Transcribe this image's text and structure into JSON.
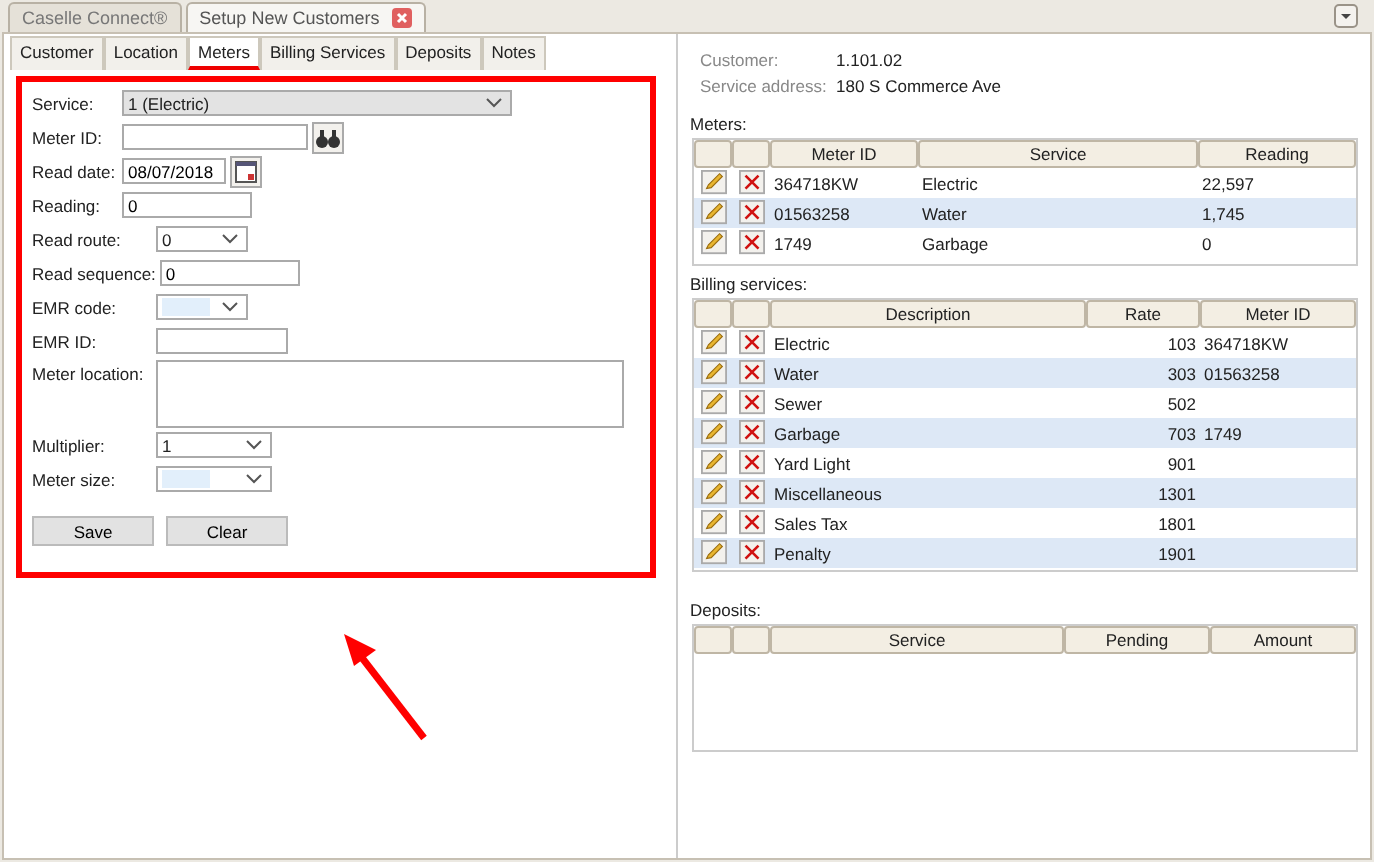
{
  "window_tabs": [
    {
      "label": "Caselle Connect®",
      "selected": false,
      "closable": false
    },
    {
      "label": "Setup New Customers",
      "selected": true,
      "closable": true
    }
  ],
  "tabs": [
    {
      "label": "Customer",
      "selected": false
    },
    {
      "label": "Location",
      "selected": false
    },
    {
      "label": "Meters",
      "selected": true
    },
    {
      "label": "Billing Services",
      "selected": false
    },
    {
      "label": "Deposits",
      "selected": false
    },
    {
      "label": "Notes",
      "selected": false
    }
  ],
  "form": {
    "fields": [
      {
        "kind": "select",
        "label": "Service:",
        "value": "1 (Electric)"
      },
      {
        "kind": "lookup",
        "label": "Meter ID:"
      },
      {
        "kind": "date",
        "label": "Read date:",
        "value": "08/07/2018"
      },
      {
        "kind": "text",
        "label": "Reading:",
        "value": "0"
      },
      {
        "kind": "select",
        "label": "Read route:",
        "value": "0"
      },
      {
        "kind": "text",
        "label": "Read sequence:",
        "value": "0"
      },
      {
        "kind": "select",
        "label": "EMR code:"
      },
      {
        "kind": "text",
        "label": "EMR ID:"
      },
      {
        "kind": "textarea",
        "label": "Meter location:"
      },
      {
        "kind": "select",
        "label": "Multiplier:",
        "value": "1"
      },
      {
        "kind": "select",
        "label": "Meter size:"
      }
    ],
    "buttons": [
      "Save",
      "Clear"
    ]
  },
  "customer": {
    "label": "Customer:",
    "value": "1.101.02"
  },
  "service_address": {
    "label": "Service address:",
    "value": "180 S Commerce Ave"
  },
  "meters": {
    "label": "Meters:",
    "columns": [
      "Meter ID",
      "Service",
      "Reading"
    ],
    "rows": [
      [
        "364718KW",
        "Electric",
        "22,597"
      ],
      [
        "01563258",
        "Water",
        "1,745"
      ],
      [
        "1749",
        "Garbage",
        "0"
      ]
    ]
  },
  "billing_services": {
    "label": "Billing services:",
    "columns": [
      "Description",
      "Rate",
      "Meter ID"
    ],
    "rows": [
      [
        "Electric",
        "103",
        "364718KW"
      ],
      [
        "Water",
        "303",
        "01563258"
      ],
      [
        "Sewer",
        "502",
        ""
      ],
      [
        "Garbage",
        "703",
        "1749"
      ],
      [
        "Yard Light",
        "901",
        ""
      ],
      [
        "Miscellaneous",
        "1301",
        ""
      ],
      [
        "Sales Tax",
        "1801",
        ""
      ],
      [
        "Penalty",
        "1901",
        ""
      ]
    ]
  },
  "deposits": {
    "label": "Deposits:",
    "columns": [
      "Service",
      "Pending",
      "Amount"
    ]
  }
}
